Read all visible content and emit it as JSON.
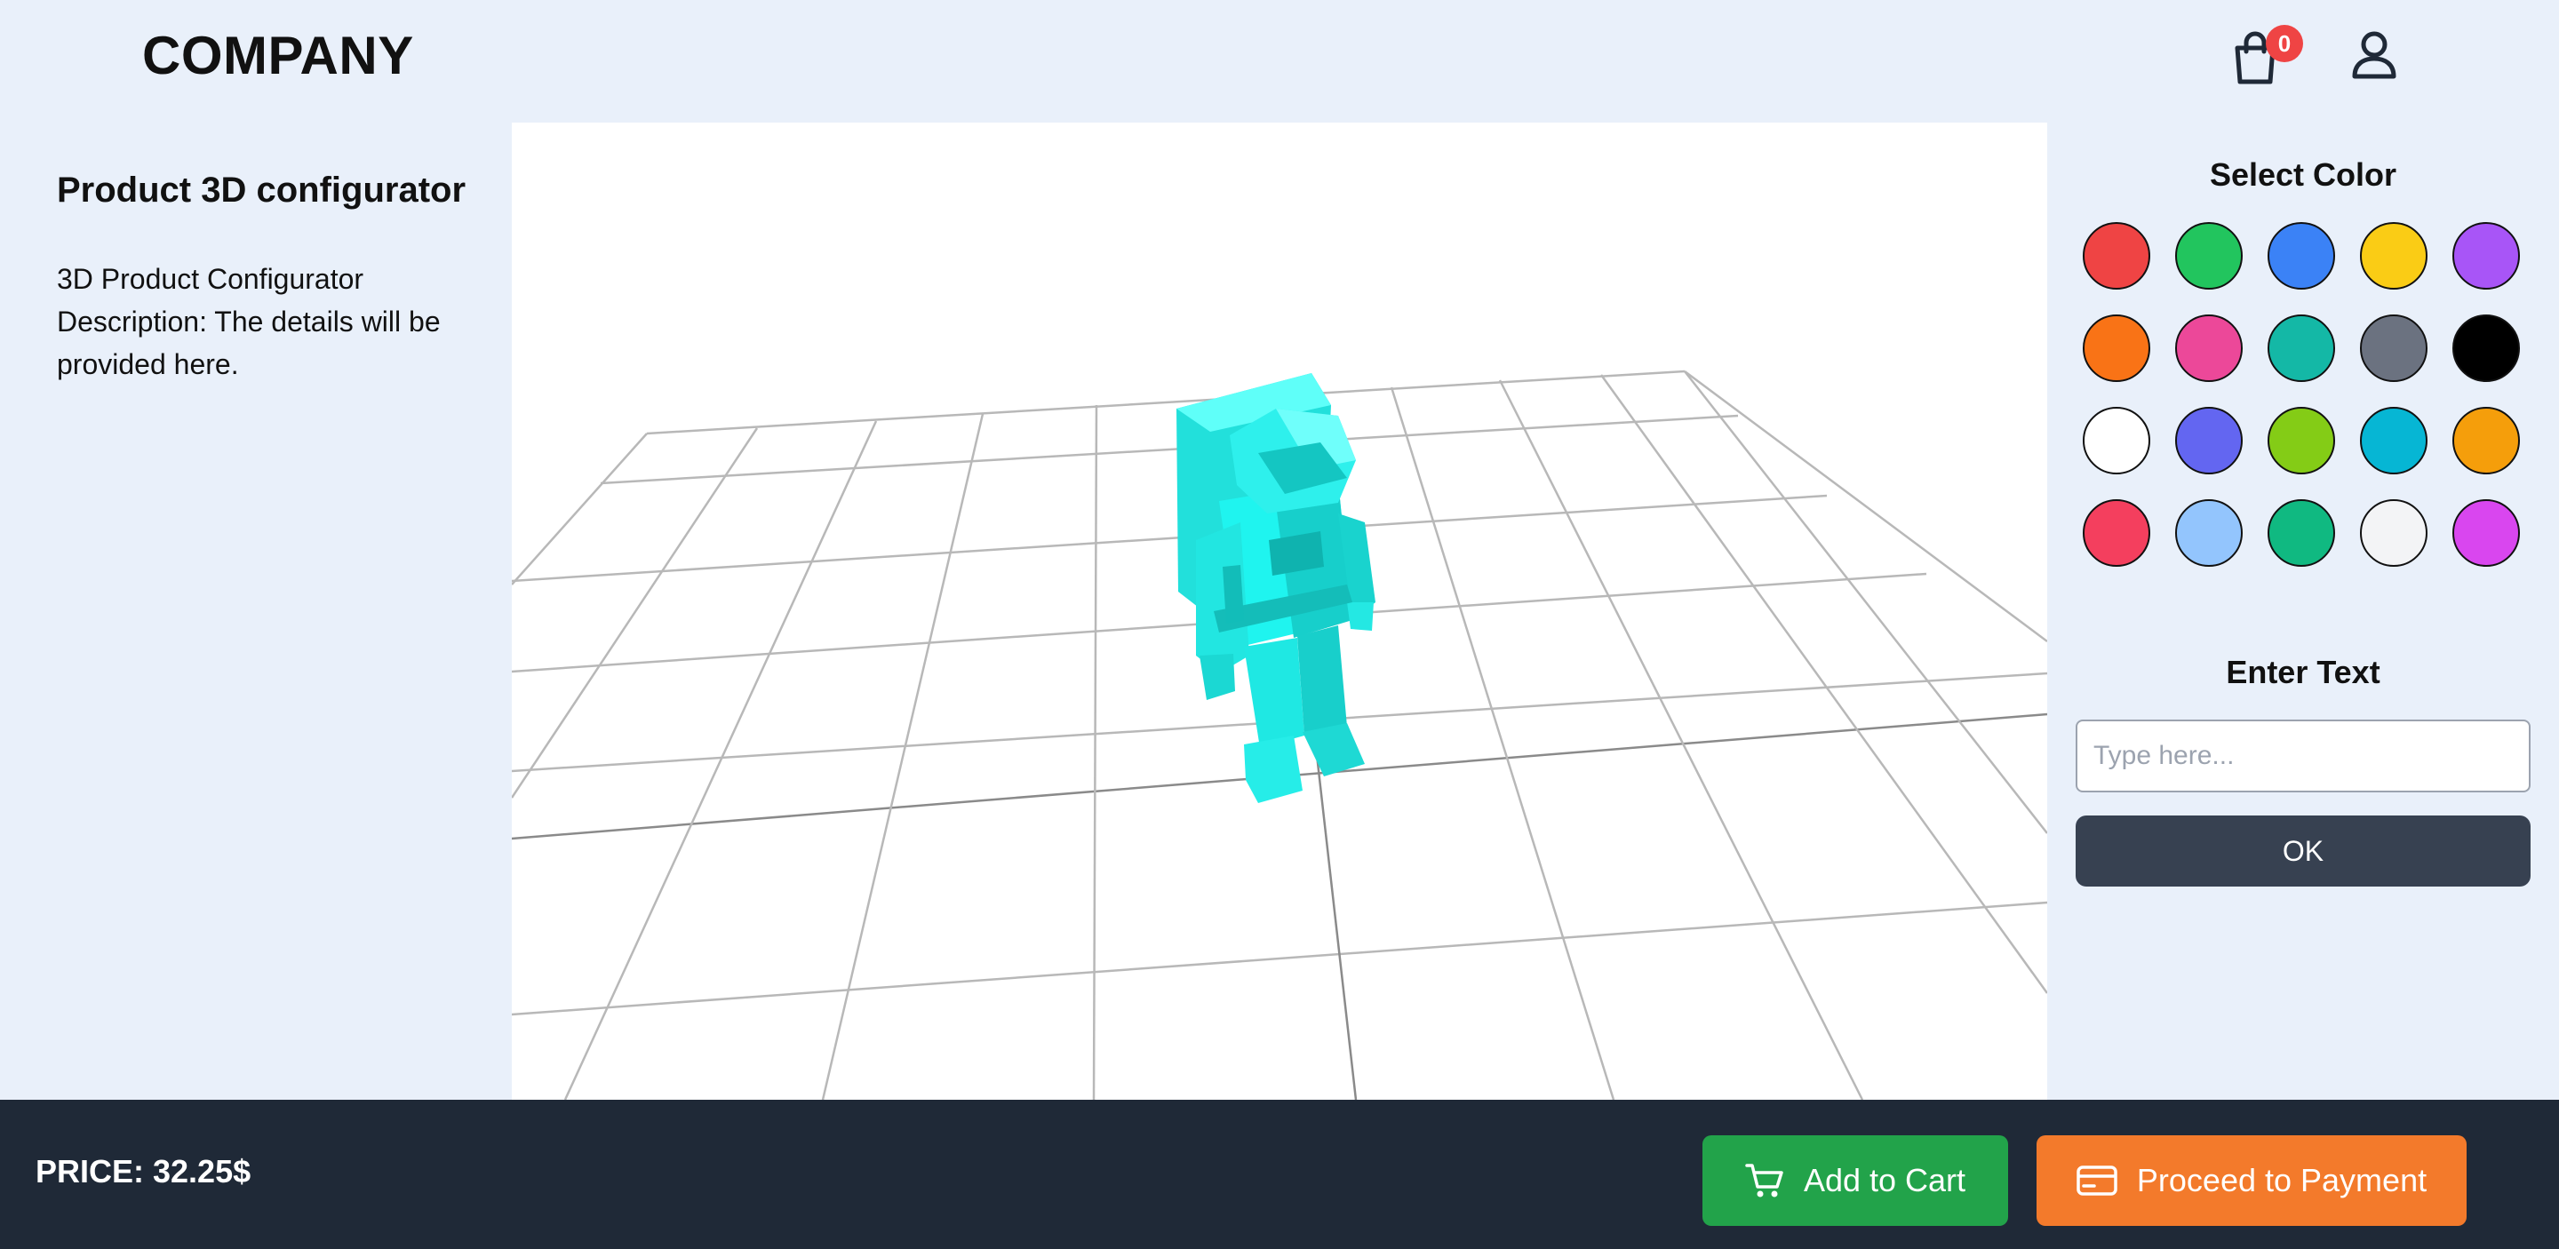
{
  "header": {
    "brand": "COMPANY",
    "cart_count": "0",
    "cart_icon": "shopping-bag-icon",
    "user_icon": "user-icon"
  },
  "left_panel": {
    "title": "Product 3D configurator",
    "description": "3D Product Configurator Description: The details will be provided here."
  },
  "viewport": {
    "model": "astronaut",
    "model_color": "#22e8e4",
    "background": "#ffffff"
  },
  "color_panel": {
    "title": "Select Color",
    "colors": [
      "#ef4444",
      "#22c55e",
      "#3b82f6",
      "#facc15",
      "#a855f7",
      "#f97316",
      "#ec4899",
      "#14b8a6",
      "#6b7280",
      "#000000",
      "#ffffff",
      "#6366f1",
      "#84cc16",
      "#06b6d4",
      "#f59e0b",
      "#f43f5e",
      "#93c5fd",
      "#10b981",
      "#f3f4f6",
      "#d946ef"
    ]
  },
  "text_panel": {
    "title": "Enter Text",
    "placeholder": "Type here...",
    "value": "",
    "ok_label": "OK"
  },
  "footer": {
    "price_label": "PRICE: 32.25$",
    "add_to_cart_label": "Add to Cart",
    "add_to_cart_icon": "cart-icon",
    "add_to_cart_color": "#22a34a",
    "payment_label": "Proceed to Payment",
    "payment_icon": "credit-card-icon",
    "payment_color": "#f37a2b"
  }
}
